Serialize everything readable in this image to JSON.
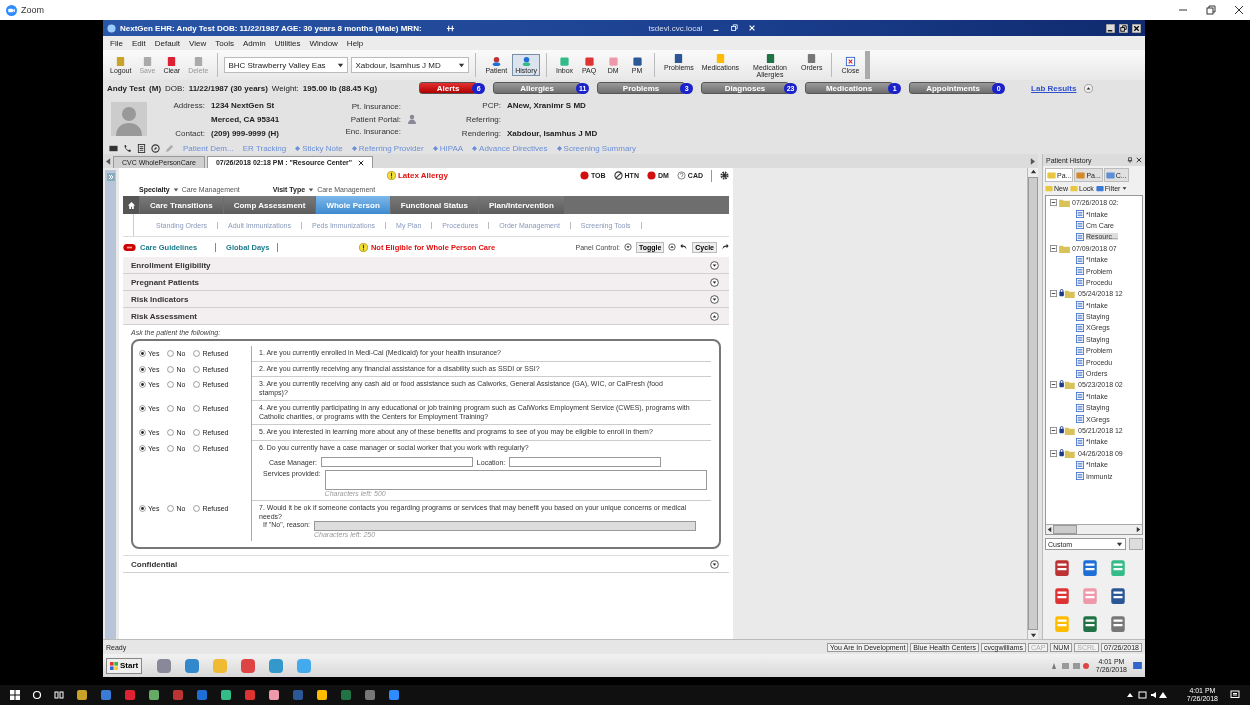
{
  "zoom": {
    "title": "Zoom"
  },
  "window": {
    "title": "NextGen EHR: Andy Test  DOB: 11/22/1987  AGE: 30 years 8 months  (Male)  MRN:",
    "host": "tsdevl.cvc.local"
  },
  "menu": [
    "File",
    "Edit",
    "Default",
    "View",
    "Tools",
    "Admin",
    "Utilities",
    "Window",
    "Help"
  ],
  "toolbar": {
    "actions": [
      {
        "label": "Logout",
        "disabled": false
      },
      {
        "label": "Save",
        "disabled": true
      },
      {
        "label": "Clear",
        "disabled": false
      },
      {
        "label": "Delete",
        "disabled": true
      }
    ],
    "location": "BHC Strawberry Valley Eas",
    "provider": "Xabdour, Isamhus J MD",
    "views": [
      {
        "label": "Patient",
        "selected": false
      },
      {
        "label": "History",
        "selected": true
      }
    ],
    "apps": [
      "Inbox",
      "PAQ",
      "DM",
      "PM"
    ],
    "modules": [
      "Problems",
      "Medications",
      "Medication Allergies",
      "Orders"
    ],
    "close": "Close"
  },
  "patient": {
    "name": "Andy Test",
    "sex": "(M)",
    "dob_label": "DOB:",
    "dob": "11/22/1987 (30 years)",
    "weight_label": "Weight:",
    "weight": "195.00 lb (88.45 Kg)"
  },
  "chips": [
    {
      "label": "Alerts",
      "count": "6",
      "kind": "alert"
    },
    {
      "label": "Allergies",
      "count": "11",
      "kind": "normal"
    },
    {
      "label": "Problems",
      "count": "3",
      "kind": "normal"
    },
    {
      "label": "Diagnoses",
      "count": "23",
      "kind": "normal"
    },
    {
      "label": "Medications",
      "count": "1",
      "kind": "normal"
    },
    {
      "label": "Appointments",
      "count": "0",
      "kind": "normal"
    }
  ],
  "lab_results": "Lab Results",
  "address": {
    "label": "Address:",
    "line1": "1234 NextGen St",
    "line2": "Merced, CA 95341",
    "contact_label": "Contact:",
    "contact": "(209) 999-9999 (H)"
  },
  "insurance": {
    "pt_label": "Pt. Insurance:",
    "portal_label": "Patient Portal:",
    "enc_label": "Enc. Insurance:"
  },
  "providers": [
    {
      "label": "PCP:",
      "value": "ANew, Xranimr S MD"
    },
    {
      "label": "Referring:"
    },
    {
      "label": "Rendering:",
      "value": "Xabdour, Isamhus J MD"
    }
  ],
  "quick_links": [
    {
      "label": "Patient Dem...",
      "bullet": false
    },
    {
      "label": "ER Tracking",
      "bullet": false
    },
    {
      "label": "Sticky Note",
      "bullet": true
    },
    {
      "label": "Referring Provider",
      "bullet": true
    },
    {
      "label": "HIPAA",
      "bullet": true
    },
    {
      "label": "Advance Directives",
      "bullet": true
    },
    {
      "label": "Screening Summary",
      "bullet": true
    }
  ],
  "doc_tabs": [
    {
      "label": "CVC WholePersonCare",
      "selected": false
    },
    {
      "label": "07/26/2018 02:18 PM : \"Resource Center\"",
      "selected": true
    }
  ],
  "form": {
    "alert": "Latex Allergy",
    "flags": [
      {
        "label": "TOB",
        "kind": "stop"
      },
      {
        "label": "HTN",
        "kind": "none"
      },
      {
        "label": "DM",
        "kind": "stop"
      },
      {
        "label": "CAD",
        "kind": "unknown"
      }
    ],
    "specialty_label": "Specialty",
    "specialty": "Care Management",
    "visit_type_label": "Visit Type",
    "visit_type": "Care Management",
    "tabs": [
      {
        "label": "Care Transitions",
        "selected": false
      },
      {
        "label": "Comp Assessment",
        "selected": false
      },
      {
        "label": "Whole Person",
        "selected": true
      },
      {
        "label": "Functional Status",
        "selected": false
      },
      {
        "label": "Plan/Intervention",
        "selected": false
      }
    ],
    "sub_tabs": [
      "Standing Orders",
      "Adult Immunizations",
      "Peds Immunizations",
      "My Plan",
      "Procedures",
      "Order Management",
      "Screening Tools"
    ],
    "care_guidelines": "Care Guidelines",
    "global_days": "Global Days",
    "eligibility": "Not Eligible for Whole Person Care",
    "panel_control": "Panel Control:",
    "toggle": "Toggle",
    "cycle": "Cycle",
    "sections": [
      {
        "title": "Enrollment Eligibility",
        "expanded": false
      },
      {
        "title": "Pregnant Patients",
        "expanded": false
      },
      {
        "title": "Risk Indicators",
        "expanded": false
      },
      {
        "title": "Risk Assessment",
        "expanded": true
      }
    ],
    "prompt": "Ask the patient the following:",
    "questions": [
      {
        "text": "1. Are you currently enrolled in Medi-Cal (Medicaid) for your health insurance?",
        "choices": [
          {
            "label": "Yes",
            "selected": true
          },
          {
            "label": "No",
            "selected": false
          },
          {
            "label": "Refused",
            "selected": false
          }
        ]
      },
      {
        "text": "2. Are you currently receiving any financial assistance for a disability such as SSDI or SSI?",
        "choices": [
          {
            "label": "Yes",
            "selected": true
          },
          {
            "label": "No",
            "selected": false
          },
          {
            "label": "Refused",
            "selected": false
          }
        ]
      },
      {
        "text": "3. Are you currently receiving any cash aid or food assistance such as Calworks, General Assistance (GA), WIC, or CalFresh (food stamps)?",
        "choices": [
          {
            "label": "Yes",
            "selected": true
          },
          {
            "label": "No",
            "selected": false
          },
          {
            "label": "Refused",
            "selected": false
          }
        ]
      },
      {
        "text": "4. Are you currently participating in any educational or job training program such as CalWorks Employment Service (CWES), programs with Catholic charities, or programs with the Centers for Employment Training?",
        "choices": [
          {
            "label": "Yes",
            "selected": true
          },
          {
            "label": "No",
            "selected": false
          },
          {
            "label": "Refused",
            "selected": false
          }
        ]
      },
      {
        "text": "5. Are you interested in learning more about any of these benefits and programs to see of you may be eligible to enroll in them?",
        "choices": [
          {
            "label": "Yes",
            "selected": true
          },
          {
            "label": "No",
            "selected": false
          },
          {
            "label": "Refused",
            "selected": false
          }
        ]
      },
      {
        "text": "6. Do you currently have a case manager or social worker that you work with regularly?",
        "choices": [
          {
            "label": "Yes",
            "selected": true
          },
          {
            "label": "No",
            "selected": false
          },
          {
            "label": "Refused",
            "selected": false
          }
        ],
        "case_manager_label": "Case Manager:",
        "location_label": "Location:",
        "services_label": "Services provided:",
        "services_counter": "Characters left: 500"
      },
      {
        "text": "7. Would it be ok if someone contacts you regarding programs or services that may benefit you based on your unique concerns or medical needs?",
        "choices": [
          {
            "label": "Yes",
            "selected": true
          },
          {
            "label": "No",
            "selected": false
          },
          {
            "label": "Refused",
            "selected": false
          }
        ],
        "reason_label": "If \"No\", reason:",
        "reason_counter": "Characters left: 250"
      }
    ],
    "footer_sections": [
      {
        "title": "Confidential",
        "expanded": false
      }
    ]
  },
  "history": {
    "title": "Patient History",
    "tabs": [
      {
        "label": "Pa...",
        "selected": true
      },
      {
        "label": "Pa...",
        "selected": false
      },
      {
        "label": "C...",
        "selected": false
      }
    ],
    "actions": [
      "New",
      "Lock",
      "Filter"
    ],
    "tree": [
      {
        "label": "07/26/2018 02:",
        "locked": false,
        "children": [
          {
            "label": "*Intake",
            "selected": false
          },
          {
            "label": "Cm Care",
            "selected": false
          },
          {
            "label": "Resourc...",
            "selected": true
          }
        ]
      },
      {
        "label": "07/09/2018 07",
        "locked": false,
        "children": [
          {
            "label": "*Intake",
            "selected": false
          },
          {
            "label": "Problem",
            "selected": false
          },
          {
            "label": "Procedu",
            "selected": false
          }
        ]
      },
      {
        "label": "05/24/2018 12",
        "locked": true,
        "children": [
          {
            "label": "*Intake",
            "selected": false
          },
          {
            "label": "Staying",
            "selected": false
          },
          {
            "label": "XGregs",
            "selected": false
          },
          {
            "label": "Staying",
            "selected": false
          },
          {
            "label": "Problem",
            "selected": false
          },
          {
            "label": "Procedu",
            "selected": false
          },
          {
            "label": "Orders",
            "selected": false
          }
        ]
      },
      {
        "label": "05/23/2018 02",
        "locked": true,
        "children": [
          {
            "label": "*Intake",
            "selected": false
          },
          {
            "label": "Staying",
            "selected": false
          },
          {
            "label": "XGregs",
            "selected": false
          }
        ]
      },
      {
        "label": "05/21/2018 12",
        "locked": true,
        "children": [
          {
            "label": "*Intake",
            "selected": false
          }
        ]
      },
      {
        "label": "04/26/2018 09",
        "locked": true,
        "children": [
          {
            "label": "*Intake",
            "selected": false
          },
          {
            "label": "Immuniz",
            "selected": false
          }
        ]
      }
    ],
    "view": "Custom"
  },
  "status": {
    "text": "Ready",
    "segments": [
      {
        "label": "You Are In Development",
        "disabled": false
      },
      {
        "label": "Blue Health Centers",
        "disabled": false
      },
      {
        "label": "cvcgwilliams",
        "disabled": false
      },
      {
        "label": "CAP",
        "disabled": true
      },
      {
        "label": "NUM",
        "disabled": false
      },
      {
        "label": "SCRL",
        "disabled": true
      },
      {
        "label": "07/26/2018",
        "disabled": false
      }
    ]
  },
  "remote_taskbar": {
    "start": "Start",
    "time": "4:01 PM",
    "date": "7/26/2018"
  },
  "win_taskbar": {
    "time": "4:01 PM",
    "date": "7/26/2018"
  }
}
